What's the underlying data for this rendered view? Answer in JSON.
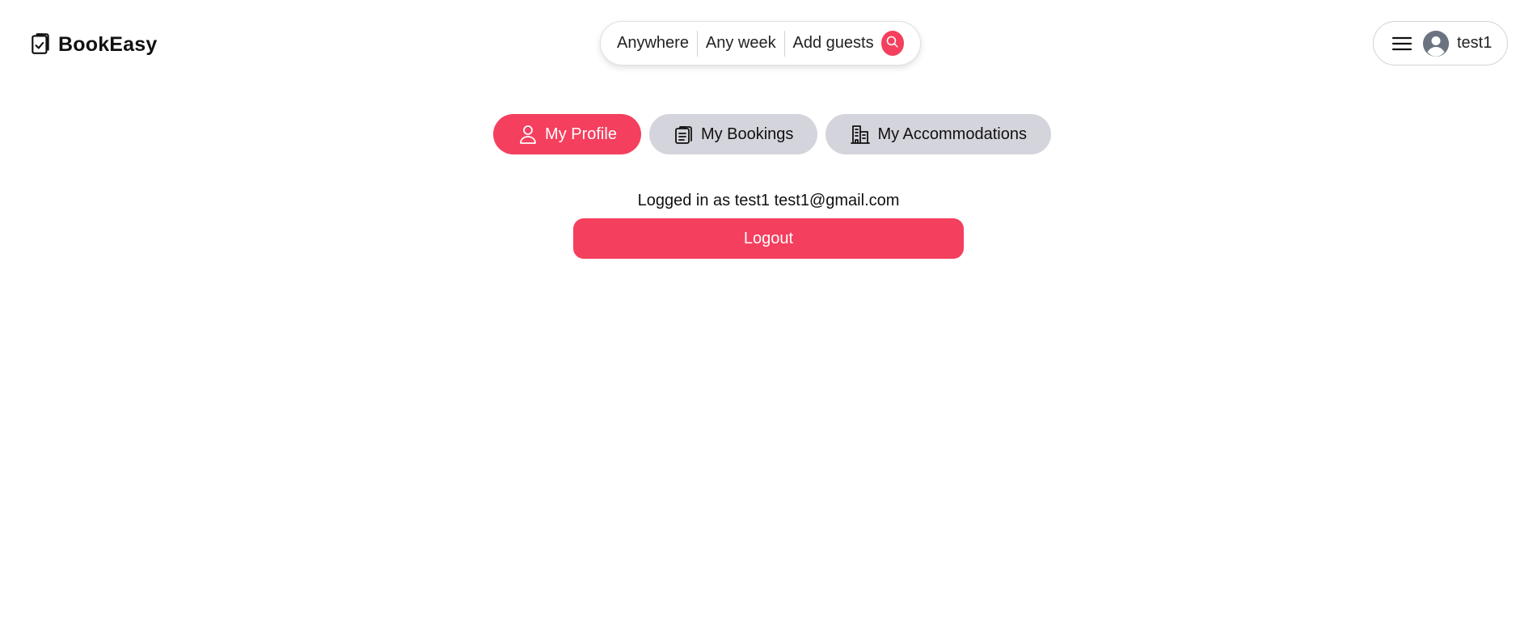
{
  "brand": {
    "name": "BookEasy",
    "icon": "clipboard-check-icon"
  },
  "search": {
    "location": "Anywhere",
    "dates": "Any week",
    "guests": "Add guests",
    "button_icon": "search-icon"
  },
  "user_menu": {
    "menu_icon": "hamburger-icon",
    "avatar_icon": "user-avatar-icon",
    "username": "test1"
  },
  "tabs": [
    {
      "label": "My Profile",
      "icon": "user-icon",
      "active": true
    },
    {
      "label": "My Bookings",
      "icon": "clipboard-list-icon",
      "active": false
    },
    {
      "label": "My Accommodations",
      "icon": "building-icon",
      "active": false
    }
  ],
  "profile": {
    "logged_in_text": "Logged in as test1 test1@gmail.com",
    "logout_label": "Logout"
  },
  "colors": {
    "accent": "#f43f5e",
    "tab_inactive": "#d4d4dc"
  }
}
